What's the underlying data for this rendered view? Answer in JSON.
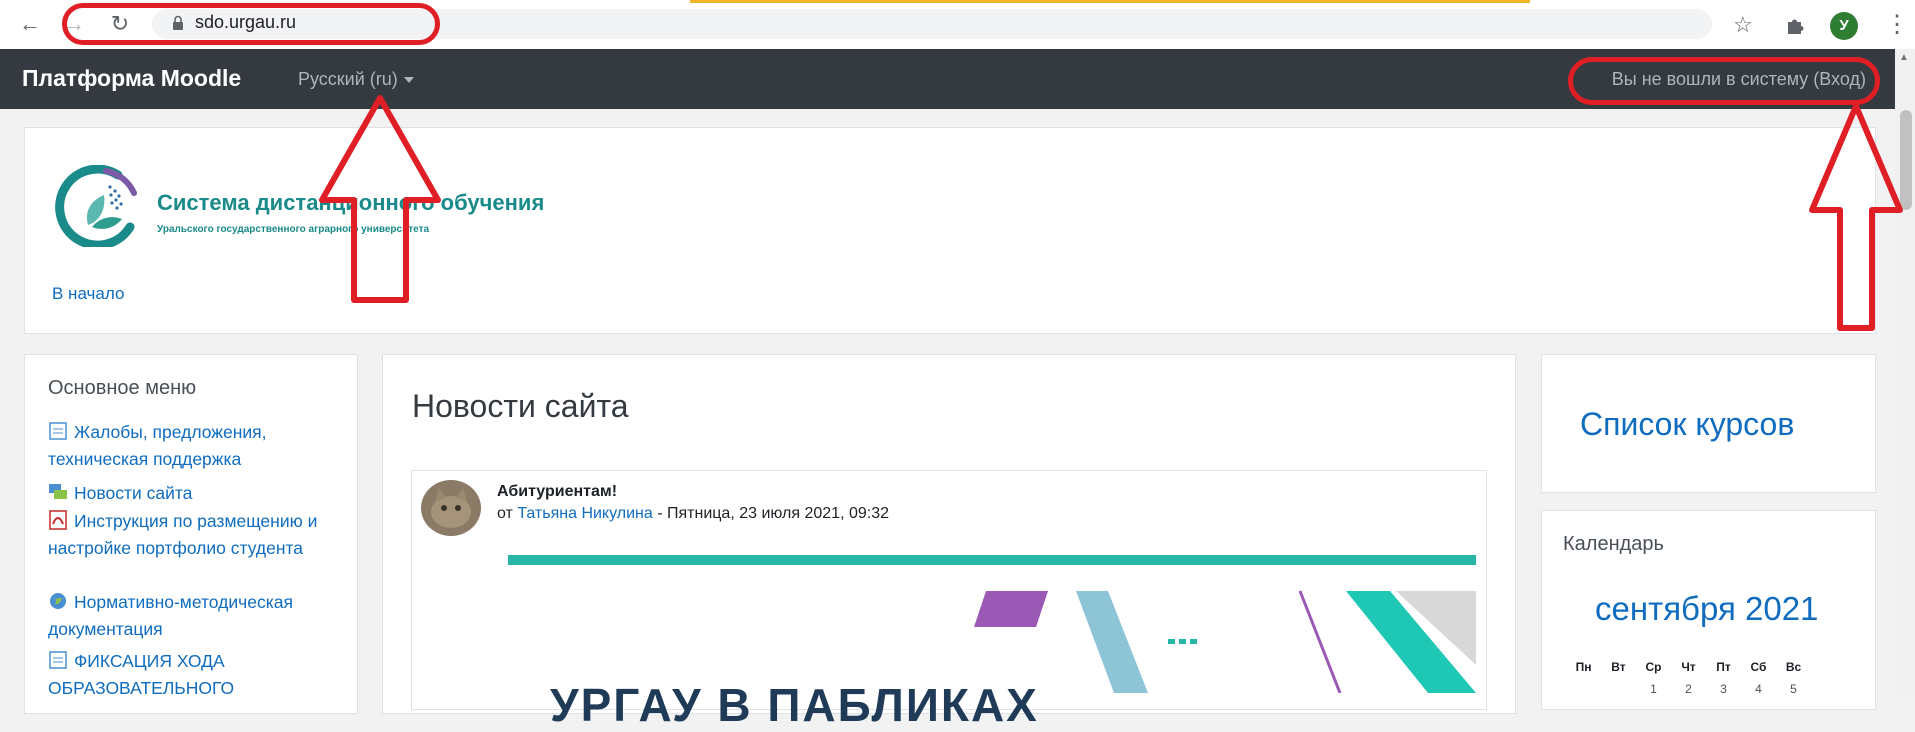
{
  "browser": {
    "url": "sdo.urgau.ru",
    "profile_initial": "У"
  },
  "navbar": {
    "brand": "Платформа Moodle",
    "language": "Русский (ru)",
    "login_text": "Вы не вошли в систему (Вход)"
  },
  "header": {
    "logo_title": "Система дистанционного обучения",
    "logo_subtitle": "Уральского государственного аграрного университета",
    "home_link": "В начало"
  },
  "main_menu": {
    "title": "Основное меню",
    "items": [
      {
        "label": "Жалобы, предложения, техническая поддержка",
        "icon": "page-icon"
      },
      {
        "label": "Новости сайта",
        "icon": "forum-icon"
      },
      {
        "label": "Инструкция по размещению и настройке портфолио студента",
        "icon": "pdf-icon"
      },
      {
        "label": "Нормативно-методическая документация",
        "icon": "globe-icon"
      },
      {
        "label": "ФИКСАЦИЯ ХОДА ОБРАЗОВАТЕЛЬНОГО",
        "icon": "page-icon"
      }
    ]
  },
  "news": {
    "heading": "Новости сайта",
    "post": {
      "title": "Абитуриентам!",
      "by_prefix": "от ",
      "author": "Татьяна Никулина",
      "date_suffix": " - Пятница, 23 июля 2021, 09:32",
      "banner_text": "УРГАУ В ПАБЛИКАХ"
    }
  },
  "courses": {
    "link": "Список курсов"
  },
  "calendar": {
    "title": "Календарь",
    "month": "сентября 2021",
    "weekdays": [
      "Пн",
      "Вт",
      "Ср",
      "Чт",
      "Пт",
      "Сб",
      "Вс"
    ],
    "first_week": [
      "",
      "",
      "1",
      "2",
      "3",
      "4",
      "5"
    ]
  },
  "colors": {
    "annotation": "#e01e26",
    "navbar_bg": "#343a40",
    "link": "#0f6cbf",
    "brand_teal": "#1a8a8a"
  }
}
